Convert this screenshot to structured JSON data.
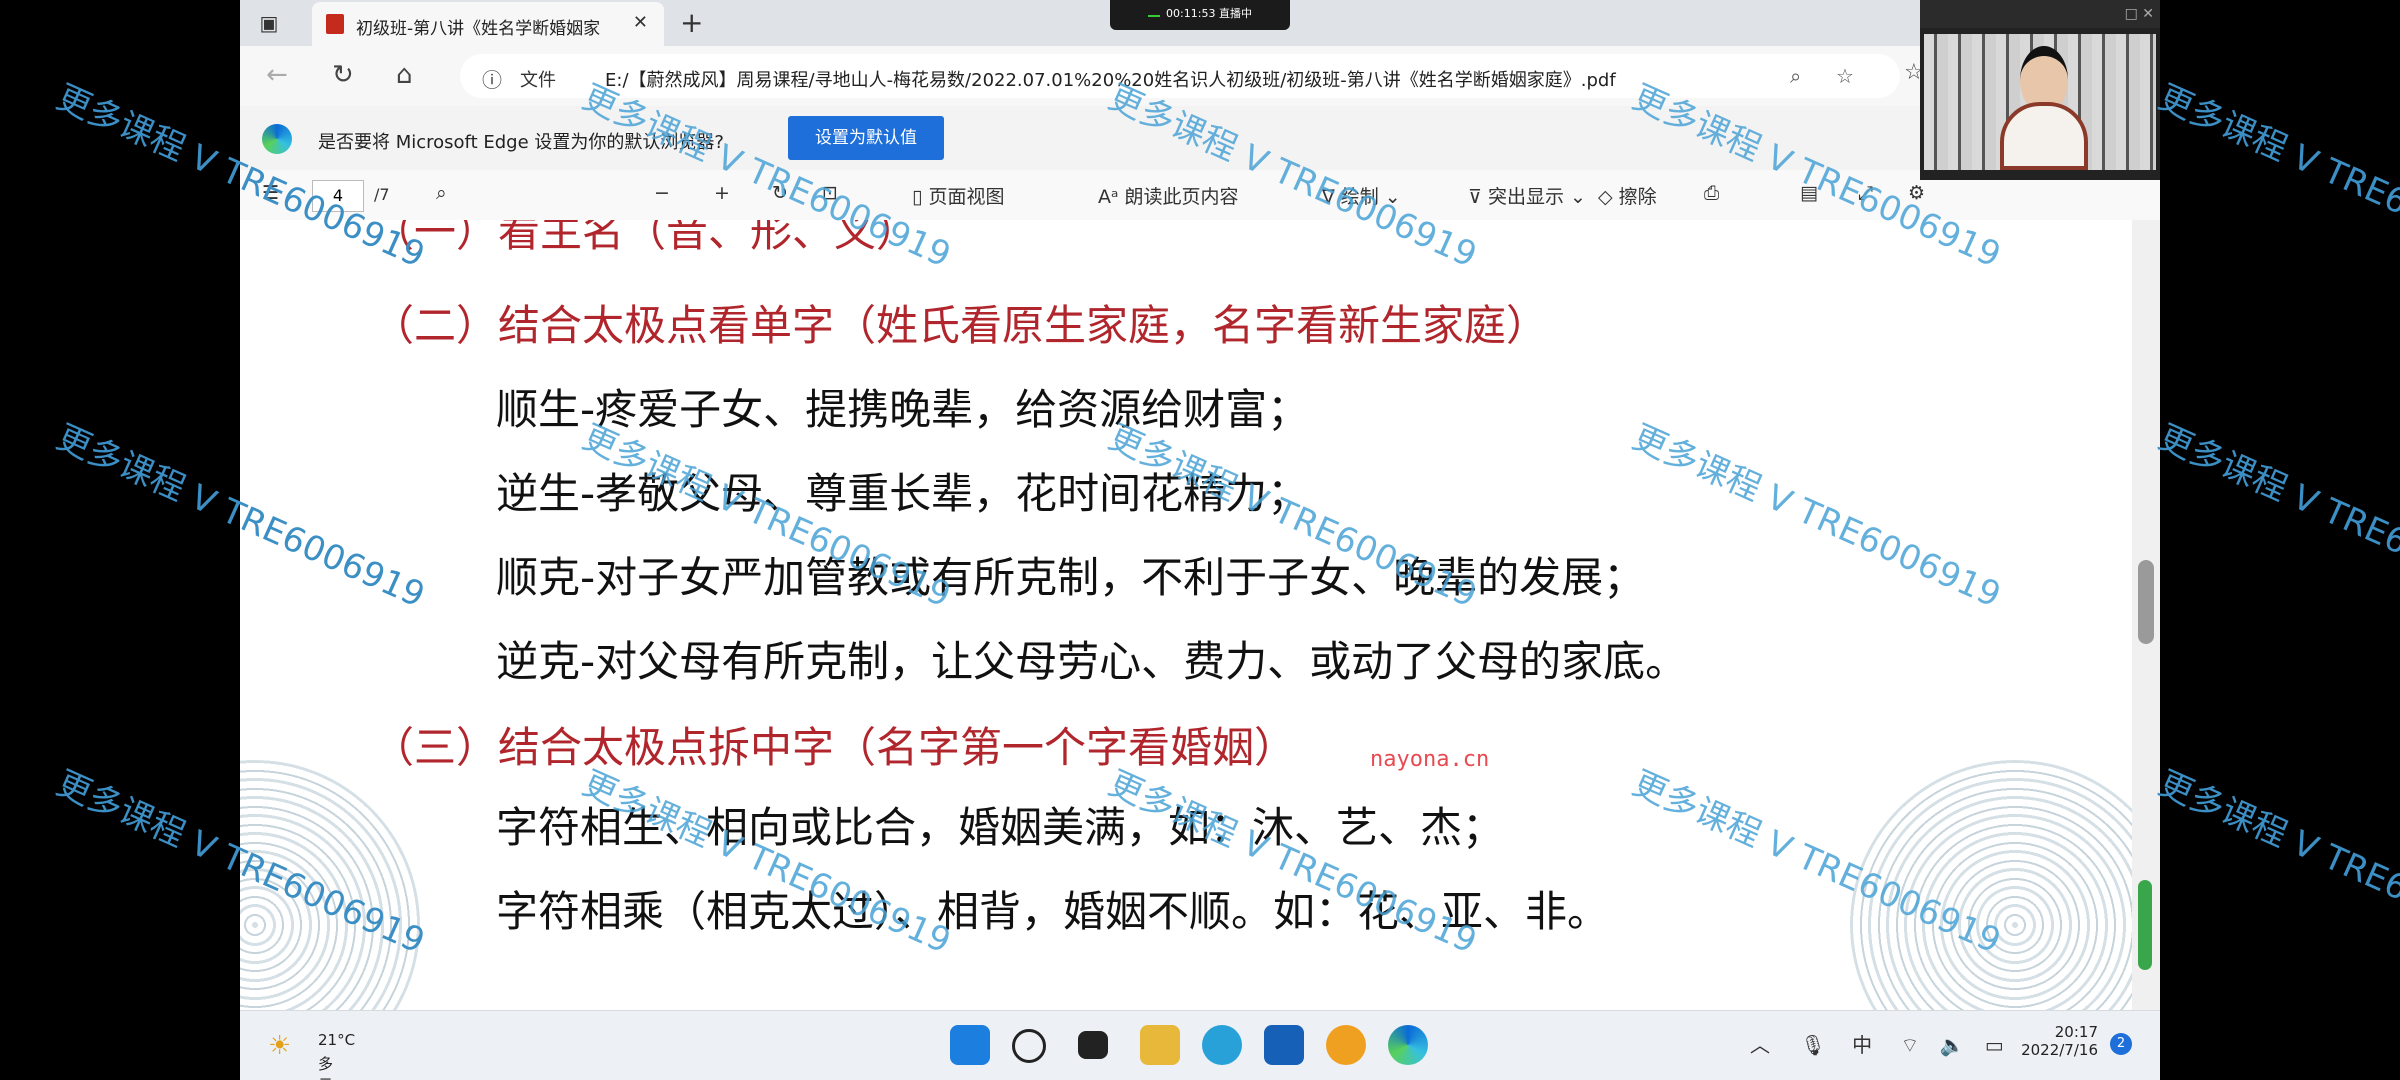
{
  "browser": {
    "tab_title": "初级班-第八讲《姓名学断婚姻家",
    "address_info": "文件",
    "address": "E:/【蔚然成风】周易课程/寻地山人-梅花易数/2022.07.01%20%20姓名识人初级班/初级班-第八讲《姓名学断婚姻家庭》.pdf",
    "live_badge": "00:11:53  直播中"
  },
  "infobar": {
    "message": "是否要将 Microsoft Edge 设置为你的默认浏览器?",
    "button": "设置为默认值"
  },
  "pdf_toolbar": {
    "page_current": "4",
    "page_total": "/7",
    "page_view": "页面视图",
    "read_aloud": "朗读此页内容",
    "draw": "绘制",
    "highlight": "突出显示",
    "erase": "擦除"
  },
  "document": {
    "partial_heading": "（一）看主名（音、形、义）",
    "section2_heading": "（二）结合太极点看单字（姓氏看原生家庭，名字看新生家庭）",
    "section2_items": [
      "顺生-疼爱子女、提携晚辈，给资源给财富；",
      "逆生-孝敬父母、尊重长辈，花时间花精力；",
      "顺克-对子女严加管教或有所克制，不利于子女、晚辈的发展；",
      "逆克-对父母有所克制，让父母劳心、费力、或动了父母的家底。"
    ],
    "section3_heading": "（三）结合太极点拆中字（名字第一个字看婚姻）",
    "section3_items": [
      "字符相生、相向或比合，婚姻美满，如：沐、艺、杰；",
      "字符相乘（相克太过）、相背，婚姻不顺。如：花、亚、非。"
    ]
  },
  "watermark": {
    "text": "更多课程 V TRE6006919",
    "center": "nayona.cn"
  },
  "taskbar": {
    "temperature": "21°C",
    "weather": "多云",
    "ime": "中",
    "time": "20:17",
    "date": "2022/7/16",
    "notifications": "2"
  }
}
